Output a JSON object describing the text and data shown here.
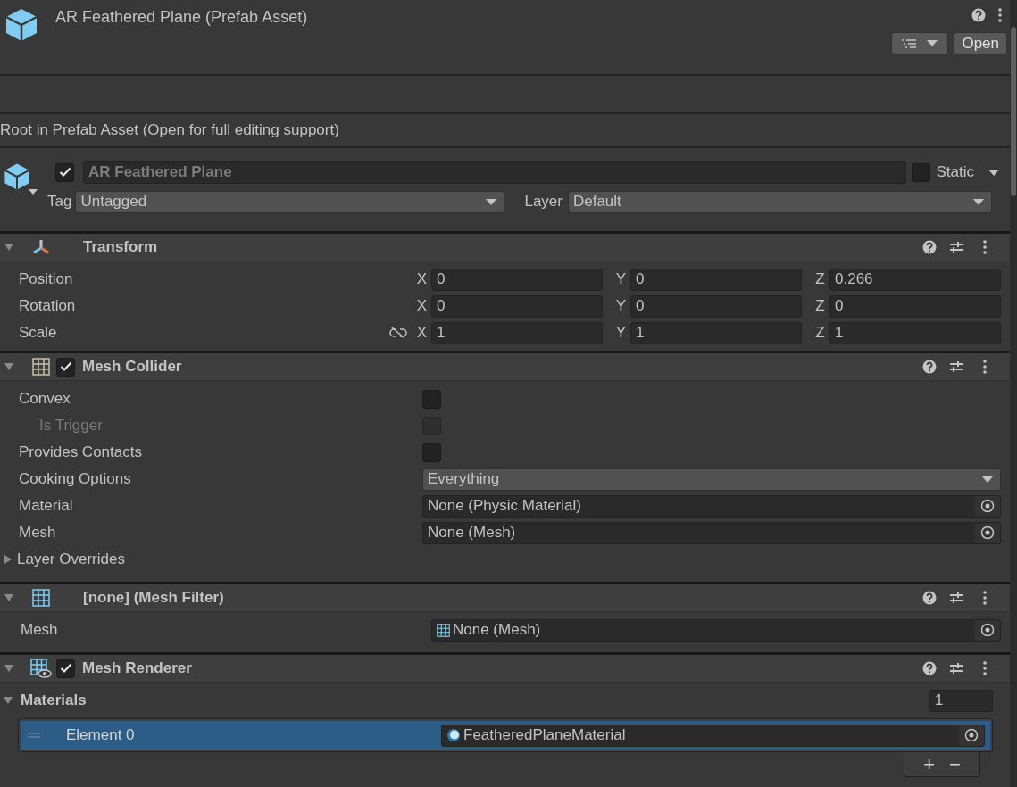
{
  "asset": {
    "title": "AR Feathered Plane (Prefab Asset)",
    "open_button": "Open"
  },
  "notice": "Root in Prefab Asset (Open for full editing support)",
  "game_object": {
    "active": true,
    "name": "AR Feathered Plane",
    "static": false,
    "static_label": "Static",
    "tag_label": "Tag",
    "tag": "Untagged",
    "layer_label": "Layer",
    "layer": "Default"
  },
  "components": [
    {
      "kind": "transform",
      "title": "Transform",
      "expanded": true,
      "rows": [
        {
          "label": "Position",
          "fields": [
            {
              "axis": "X",
              "value": "0"
            },
            {
              "axis": "Y",
              "value": "0"
            },
            {
              "axis": "Z",
              "value": "0.266"
            }
          ]
        },
        {
          "label": "Rotation",
          "fields": [
            {
              "axis": "X",
              "value": "0"
            },
            {
              "axis": "Y",
              "value": "0"
            },
            {
              "axis": "Z",
              "value": "0"
            }
          ]
        },
        {
          "label": "Scale",
          "constrained": false,
          "fields": [
            {
              "axis": "X",
              "value": "1"
            },
            {
              "axis": "Y",
              "value": "1"
            },
            {
              "axis": "Z",
              "value": "1"
            }
          ]
        }
      ]
    },
    {
      "kind": "mesh_collider",
      "title": "Mesh Collider",
      "expanded": true,
      "enabled": true,
      "rows": [
        {
          "kind": "checkbox",
          "label": "Convex",
          "checked": false,
          "disabled": false,
          "children": [
            {
              "kind": "checkbox",
              "label": "Is Trigger",
              "checked": false,
              "disabled": true
            }
          ]
        },
        {
          "kind": "checkbox",
          "label": "Provides Contacts",
          "checked": false,
          "disabled": false
        },
        {
          "kind": "dropdown",
          "label": "Cooking Options",
          "value": "Everything"
        },
        {
          "kind": "object",
          "label": "Material",
          "value": "None (Physic Material)"
        },
        {
          "kind": "object",
          "label": "Mesh",
          "value": "None (Mesh)"
        },
        {
          "kind": "foldout",
          "label": "Layer Overrides",
          "expanded": false
        }
      ]
    },
    {
      "kind": "mesh_filter",
      "title": "[none] (Mesh Filter)",
      "expanded": true,
      "rows": [
        {
          "kind": "object",
          "label": "Mesh",
          "value": "None (Mesh)"
        }
      ]
    },
    {
      "kind": "mesh_renderer",
      "title": "Mesh Renderer",
      "expanded": true,
      "enabled": true,
      "materials": {
        "label": "Materials",
        "expanded": true,
        "count": "1",
        "elements": [
          {
            "label": "Element 0",
            "value": "FeatheredPlaneMaterial",
            "selected": true
          }
        ],
        "add": "+",
        "remove": "−"
      }
    }
  ]
}
